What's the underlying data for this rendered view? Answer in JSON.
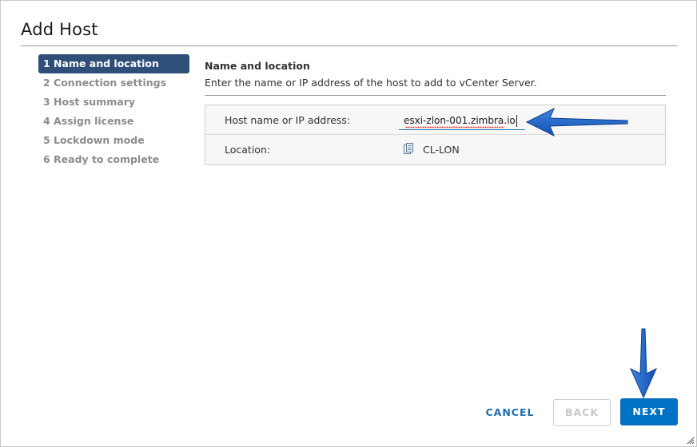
{
  "dialog": {
    "title": "Add Host"
  },
  "steps": [
    {
      "label": "1 Name and location",
      "active": true
    },
    {
      "label": "2 Connection settings",
      "active": false
    },
    {
      "label": "3 Host summary",
      "active": false
    },
    {
      "label": "4 Assign license",
      "active": false
    },
    {
      "label": "5 Lockdown mode",
      "active": false
    },
    {
      "label": "6 Ready to complete",
      "active": false
    }
  ],
  "main": {
    "section_title": "Name and location",
    "section_desc": "Enter the name or IP address of the host to add to vCenter Server.",
    "form": {
      "host_label": "Host name or IP address:",
      "host_value": "esxi-zlon-001.zimbra.io",
      "location_label": "Location:",
      "location_icon": "datacenter-icon",
      "location_value": "CL-LON"
    }
  },
  "footer": {
    "cancel_label": "CANCEL",
    "back_label": "BACK",
    "next_label": "NEXT"
  },
  "colors": {
    "active_step_bg": "#2e4f78",
    "primary_button": "#0072c6",
    "link_blue": "#1f6fb0",
    "annotation_arrow": "#1a5fc4"
  }
}
